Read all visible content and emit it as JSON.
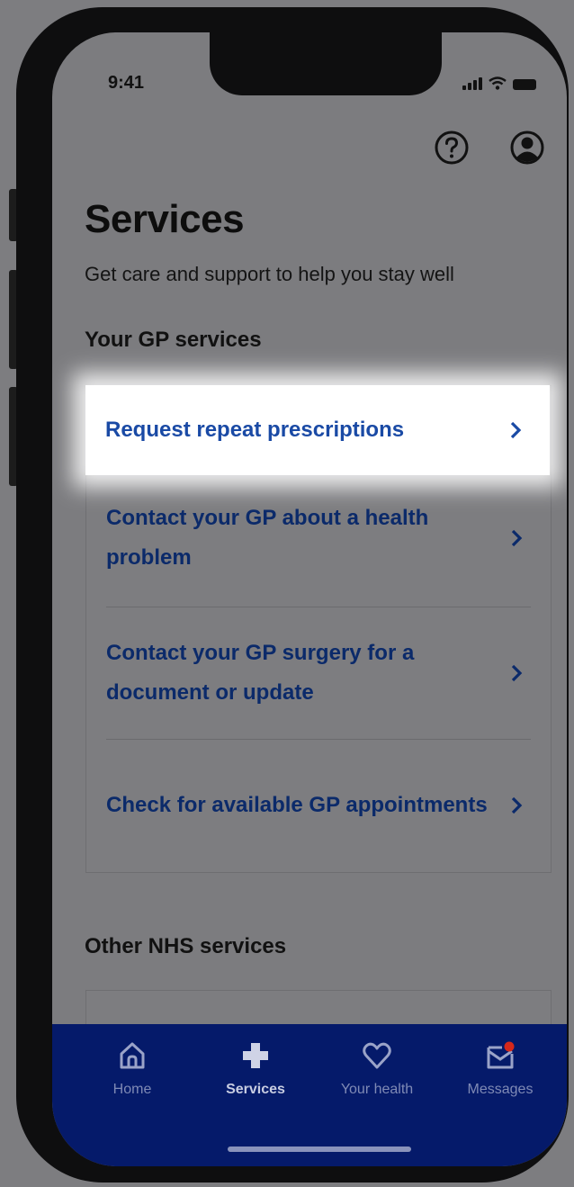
{
  "status_bar": {
    "time": "9:41"
  },
  "header": {
    "help_icon": "help-circle-icon",
    "account_icon": "account-circle-icon"
  },
  "page": {
    "title": "Services",
    "subtitle": "Get care and support to help you stay well"
  },
  "gp_services": {
    "heading": "Your GP services",
    "items": [
      {
        "label": "Request repeat prescriptions",
        "highlighted": true
      },
      {
        "label": "Contact your GP about a health problem"
      },
      {
        "label": "Contact your GP surgery for a document or update"
      },
      {
        "label": "Check for available GP appointments"
      }
    ]
  },
  "other_services": {
    "heading": "Other NHS services"
  },
  "tab_bar": {
    "tabs": [
      {
        "label": "Home",
        "icon": "home-icon"
      },
      {
        "label": "Services",
        "icon": "plus-icon",
        "active": true
      },
      {
        "label": "Your health",
        "icon": "heart-icon"
      },
      {
        "label": "Messages",
        "icon": "envelope-icon",
        "badge": true
      }
    ]
  },
  "colors": {
    "link": "#0b2a6a",
    "highlight_link": "#1a4aa5",
    "tab_bar": "#051a6a",
    "badge": "#d5281b"
  }
}
